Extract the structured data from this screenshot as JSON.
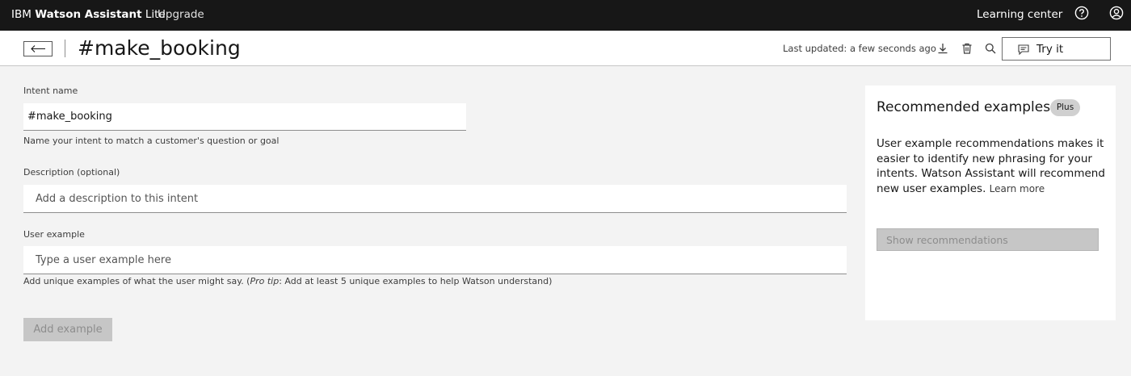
{
  "topbar": {
    "brand_ibm": "IBM",
    "brand_name": "Watson Assistant",
    "brand_lite": "Lite",
    "upgrade": "Upgrade",
    "learning_center": "Learning center"
  },
  "header": {
    "title": "#make_booking",
    "last_updated": "Last updated: a few seconds ago",
    "try_it": "Try it"
  },
  "form": {
    "intent_label": "Intent name",
    "intent_value": "#make_booking",
    "intent_helper": "Name your intent to match a customer's question or goal",
    "description_label": "Description (optional)",
    "description_placeholder": "Add a description to this intent",
    "example_label": "User example",
    "example_placeholder": "Type a user example here",
    "example_helper_before": "Add unique examples of what the user might say. (",
    "example_helper_protip": "Pro tip",
    "example_helper_after": ": Add at least 5 unique examples to help Watson understand)",
    "add_example": "Add example"
  },
  "recommended": {
    "title": "Recommended examples",
    "badge": "Plus",
    "body": "User example recommendations makes it easier to identify new phrasing for your intents. Watson Assistant will recommend new user examples.",
    "learn_more": "Learn more",
    "show_button": "Show recommendations"
  },
  "icons": {
    "help": "help-circle-icon",
    "user": "user-avatar-icon",
    "back": "arrow-left-icon",
    "download": "download-icon",
    "trash": "trash-icon",
    "search": "search-icon",
    "chat": "chat-icon"
  },
  "colors": {
    "topbar_bg": "#171717",
    "page_bg": "#f3f3f3",
    "disabled_button": "#c6c6c6"
  }
}
